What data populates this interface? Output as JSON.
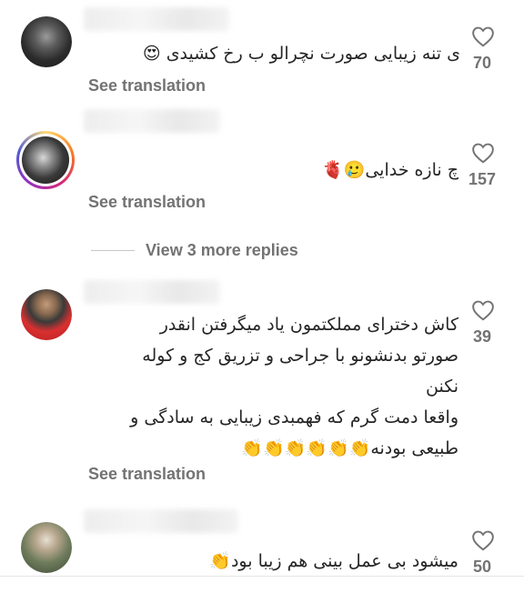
{
  "comments": [
    {
      "text": "ی تنه زیبایی صورت نچرالو ب رخ کشیدی 😍",
      "translate_label": "See translation",
      "likes": "70"
    },
    {
      "text": "چ نازه خدایی🥲🫀",
      "translate_label": "See translation",
      "likes": "157"
    },
    {
      "text": "کاش دخترای مملکتمون یاد میگرفتن انقدر\nصورتو بدنشونو با جراحی و تزریق کج و کوله\nنکنن\nواقعا دمت گرم که فهمبدی زیبایی به سادگی و\nطبیعی بودنه👏👏👏👏👏👏",
      "translate_label": "See translation",
      "likes": "39"
    },
    {
      "text": "میشود بی عمل بینی هم زیبا بود👏",
      "likes": "50"
    }
  ],
  "replies": {
    "label": "View 3 more replies"
  },
  "colors": {
    "secondary_text": "#737373",
    "primary_text": "#262626"
  },
  "icons": {
    "like": "heart-outline-icon"
  }
}
